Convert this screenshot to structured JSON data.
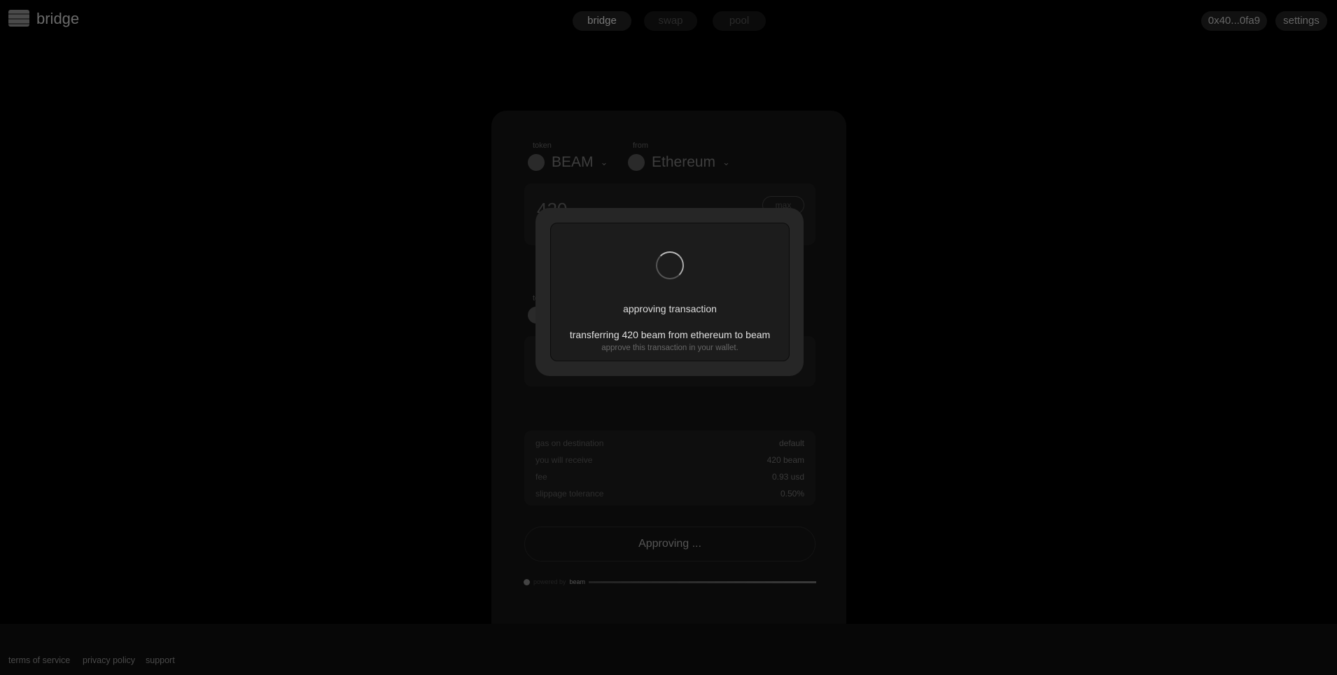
{
  "header": {
    "brand": "bridge",
    "nav": [
      {
        "label": "bridge",
        "active": true
      },
      {
        "label": "swap"
      },
      {
        "label": "pool"
      }
    ],
    "wallet": "0x40...0fa9",
    "settings": "settings"
  },
  "form": {
    "token_label": "token",
    "token": "BEAM",
    "from_label": "from",
    "from": "Ethereum",
    "amount": "420",
    "max": "max",
    "to_label": "to",
    "details": [
      {
        "label": "gas on destination",
        "value": "default"
      },
      {
        "label": "you will receive",
        "value": "420 beam"
      },
      {
        "label": "fee",
        "value": "0.93 usd"
      },
      {
        "label": "slippage tolerance",
        "value": "0.50%"
      }
    ],
    "submit": "Approving ...",
    "powered_by": "powered by",
    "powered_brand": "beam"
  },
  "modal": {
    "title": "approving transaction",
    "message": "transferring 420 beam from ethereum to beam",
    "hint": "approve this transaction in your wallet."
  },
  "footer": {
    "links": [
      "terms of service",
      "privacy policy",
      "support"
    ]
  }
}
